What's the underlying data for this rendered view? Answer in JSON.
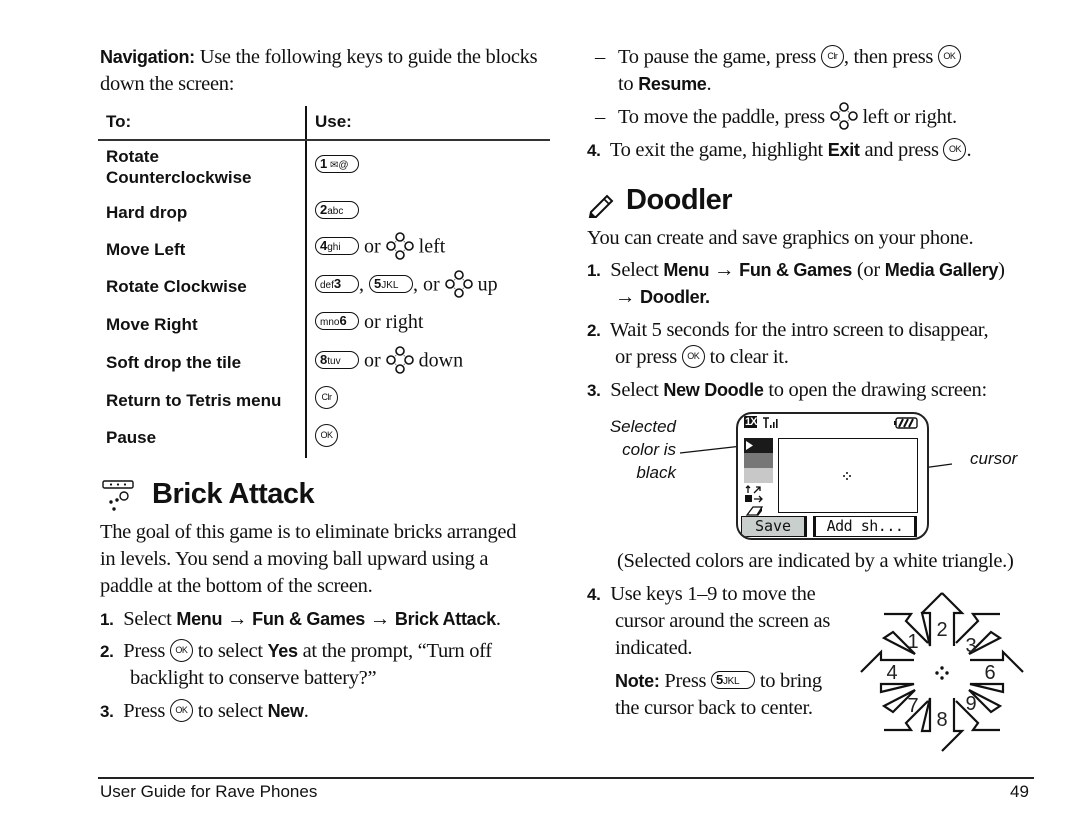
{
  "left": {
    "intro": {
      "label": "Navigation:",
      "text_line1": "Use the following keys to guide the blocks",
      "text_line2": "down the screen:"
    },
    "table": {
      "col_to": "To:",
      "col_use": "Use:",
      "rows": [
        {
          "action_line1": "Rotate",
          "action_line2": "Counterclockwise",
          "keys": [
            "1-key"
          ],
          "suffix": ""
        },
        {
          "action_line1": "Hard drop",
          "keys": [
            "2-key"
          ],
          "suffix": ""
        },
        {
          "action_line1": "Move Left",
          "keys": [
            "4-key"
          ],
          "connector": "or",
          "nav": "nav-key",
          "suffix": "left"
        },
        {
          "action_line1": "Rotate Clockwise",
          "keys": [
            "3-key",
            "5-key"
          ],
          "connector": ", or",
          "nav": "nav-key",
          "suffix": "up"
        },
        {
          "action_line1": "Move Right",
          "keys": [
            "6-key"
          ],
          "suffix": "or right"
        },
        {
          "action_line1": "Soft drop the tile",
          "keys": [
            "8-key"
          ],
          "connector": "or",
          "nav": "nav-key",
          "suffix": "down"
        },
        {
          "action_line1": "Return to Tetris menu",
          "keys": [
            "clr-key"
          ],
          "suffix": ""
        },
        {
          "action_line1": "Pause",
          "keys": [
            "ok-key"
          ],
          "suffix": ""
        }
      ]
    },
    "key_glyphs": {
      "k1_num": "1",
      "k1_sym": "✉@",
      "k2_num": "2",
      "k2_sym": "abc",
      "k3_num": "3",
      "k3_sym": "def",
      "k4_num": "4",
      "k4_sym": "ghi",
      "k5_num": "5",
      "k5_sym": "JKL",
      "k6_num": "6",
      "k6_sym": "mno",
      "k8_num": "8",
      "k8_sym": "tuv",
      "clr": "Clr",
      "ok": "OK"
    },
    "words": {
      "or": "or",
      "comma": ",",
      "comma_or": ", or",
      "left": "left",
      "up": "up",
      "or_right": "or right",
      "down": "down"
    },
    "brick_attack": {
      "title": "Brick Attack",
      "icon": "brick-attack-icon",
      "desc_line1": "The goal of this game is to eliminate bricks arranged",
      "desc_line2": "in levels. You send a moving ball upward using a",
      "desc_line3": "paddle at the bottom of the screen.",
      "steps": [
        {
          "num": "1.",
          "pre": "Select",
          "b1": "Menu",
          "arrow1": "→",
          "b2": "Fun & Games",
          "arrow2": "→",
          "b3": "Brick Attack",
          "end": "."
        },
        {
          "num": "2.",
          "pre": "Press",
          "mid": "to select",
          "b1": "Yes",
          "post": "at the prompt, “Turn off",
          "line2": "backlight to conserve battery?”"
        },
        {
          "num": "3.",
          "pre": "Press",
          "mid": "to select",
          "b1": "New",
          "end": "."
        }
      ]
    }
  },
  "right": {
    "bullets": [
      {
        "dash": "–",
        "pre": "To pause the game, press",
        "mid": ", then press",
        "line2_pre": "to",
        "line2_b": "Resume",
        "line2_end": "."
      },
      {
        "dash": "–",
        "pre": "To move the paddle, press",
        "post": "left or right."
      }
    ],
    "step4": {
      "num": "4.",
      "pre": "To exit the game, highlight",
      "b1": "Exit",
      "post": "and press",
      "end": "."
    },
    "doodler": {
      "title": "Doodler",
      "icon": "pencil-icon",
      "intro": "You can create and save graphics on your phone.",
      "steps": [
        {
          "num": "1.",
          "pre": "Select",
          "b1": "Menu",
          "arrow1": "→",
          "b2": "Fun & Games",
          "paren_open": "(or",
          "b3": "Media Gallery",
          "paren_close": ")",
          "arrow2": "→",
          "b4": "Doodler."
        },
        {
          "num": "2.",
          "line1": "Wait 5 seconds for the intro screen to disappear,",
          "line2_pre": "or press",
          "line2_post": "to clear it."
        },
        {
          "num": "3.",
          "pre": "Select",
          "b1": "New Doodle",
          "post": "to open the drawing screen:"
        }
      ],
      "phone_screen": {
        "status_network": "1X",
        "selected_color": "black",
        "palette": [
          "#1a1a1a",
          "#777777",
          "#c8c8c8"
        ],
        "softkey_left": "Save",
        "softkey_right": "Add sh..."
      },
      "callout_selected_l1": "Selected",
      "callout_selected_l2": "color is",
      "callout_selected_l3": "black",
      "callout_cursor": "cursor",
      "caption": "(Selected colors are indicated by a white triangle.)",
      "step4": {
        "num": "4.",
        "line1": "Use keys 1–9 to move the",
        "line2": "cursor around the screen as",
        "line3": "indicated."
      },
      "note": {
        "label": "Note:",
        "pre": "Press",
        "post": "to bring",
        "line2": "the cursor back to center."
      },
      "direction_keys": [
        "1",
        "2",
        "3",
        "4",
        "6",
        "7",
        "8",
        "9"
      ]
    }
  },
  "footer": {
    "title": "User Guide for Rave Phones",
    "page_number": "49"
  }
}
